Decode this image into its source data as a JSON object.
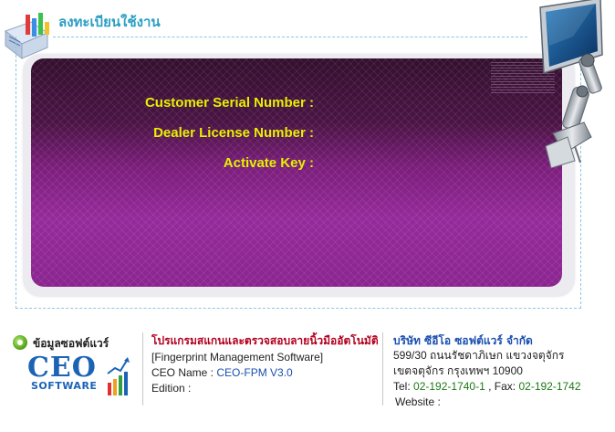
{
  "header": {
    "title": "ลงทะเบียนใช้งาน",
    "icon": "register-chart-icon"
  },
  "form": {
    "fields": [
      {
        "label": "Customer Serial Number :",
        "value": ""
      },
      {
        "label": "Dealer License Number :",
        "value": ""
      },
      {
        "label": "Activate Key :",
        "value": ""
      }
    ]
  },
  "colors": {
    "accent": "#2a9ec4",
    "panel_purple": "#7c1e7c",
    "label_yellow": "#e8f000",
    "program_title_red": "#b2001e",
    "company_blue": "#1a4fb0"
  },
  "software_info": {
    "title": "ข้อมูลซอฟต์แวร์",
    "logo_main": "CEO",
    "logo_sub": "SOFTWARE",
    "program_title": "โปรแกรมสแกนและตรวจสอบลายนิ้วมืออัตโนมัติ",
    "program_en": "[Fingerprint Management Software]",
    "ceo_name_label": "CEO Name :",
    "ceo_name_value": "CEO-FPM V3.0",
    "edition_label": "Edition :",
    "edition_value": ""
  },
  "company": {
    "name": "บริษัท ซีอีโอ ซอฟต์แวร์ จำกัด",
    "address_line1": "599/30 ถนนรัชดาภิเษก แขวงจตุจักร",
    "address_line2": "เขตจตุจักร กรุงเทพฯ 10900",
    "tel_label": "Tel:",
    "tel_value": "02-192-1740-1",
    "fax_label": ", Fax:",
    "fax_value": "02-192-1742",
    "website_label": "Website :",
    "website_value": ""
  }
}
